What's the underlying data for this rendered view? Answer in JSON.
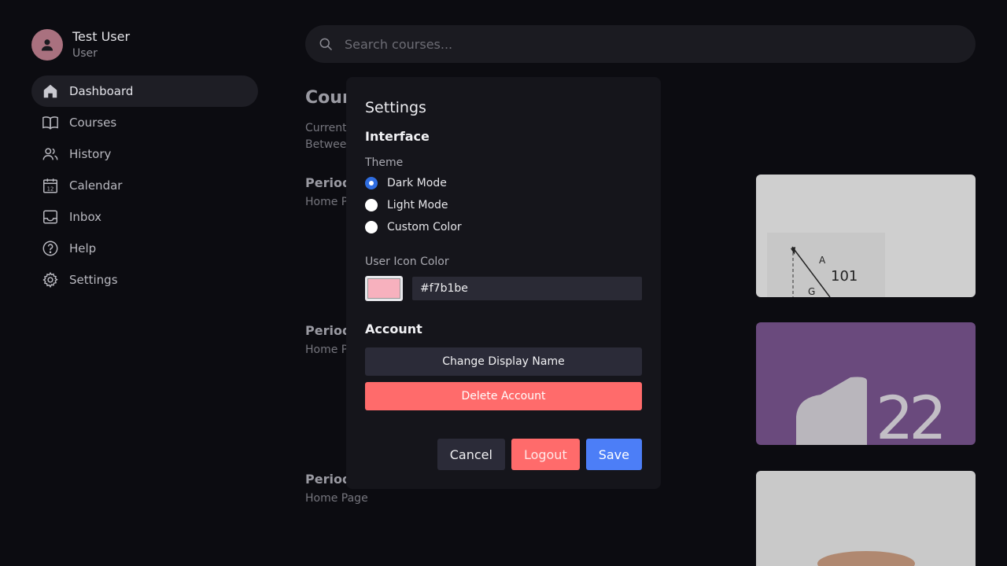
{
  "user": {
    "name": "Test User",
    "role": "User",
    "avatar_color": "#a9717f"
  },
  "nav": {
    "items": [
      {
        "label": "Dashboard",
        "icon": "home-icon",
        "active": true
      },
      {
        "label": "Courses",
        "icon": "book-icon"
      },
      {
        "label": "History",
        "icon": "users-icon"
      },
      {
        "label": "Calendar",
        "icon": "calendar-icon",
        "icon_text": "12"
      },
      {
        "label": "Inbox",
        "icon": "inbox-icon"
      },
      {
        "label": "Help",
        "icon": "help-icon"
      },
      {
        "label": "Settings",
        "icon": "gear-icon"
      }
    ]
  },
  "search": {
    "placeholder": "Search courses..."
  },
  "background": {
    "title": "Cour",
    "sub1": "Current",
    "sub2": "Betweer",
    "periods": [
      {
        "title": "Period",
        "sub": "Home P"
      },
      {
        "title": "Period",
        "sub": "Home P"
      },
      {
        "title": "Period",
        "sub": "Home Page"
      }
    ],
    "card1_labels": {
      "a": "A",
      "num": "101",
      "g": "G"
    },
    "card2_number": "22"
  },
  "settings": {
    "title": "Settings",
    "interface_heading": "Interface",
    "theme_label": "Theme",
    "theme_options": [
      "Dark Mode",
      "Light Mode",
      "Custom Color"
    ],
    "selected_theme": "Dark Mode",
    "icon_color_label": "User Icon Color",
    "icon_color_value": "#f7b1be",
    "account_heading": "Account",
    "change_name_label": "Change Display Name",
    "delete_label": "Delete Account",
    "cancel_label": "Cancel",
    "logout_label": "Logout",
    "save_label": "Save"
  },
  "colors": {
    "accent": "#4c7ef7",
    "danger": "#ff6b6b",
    "radio_selected": "#2f6de0"
  }
}
